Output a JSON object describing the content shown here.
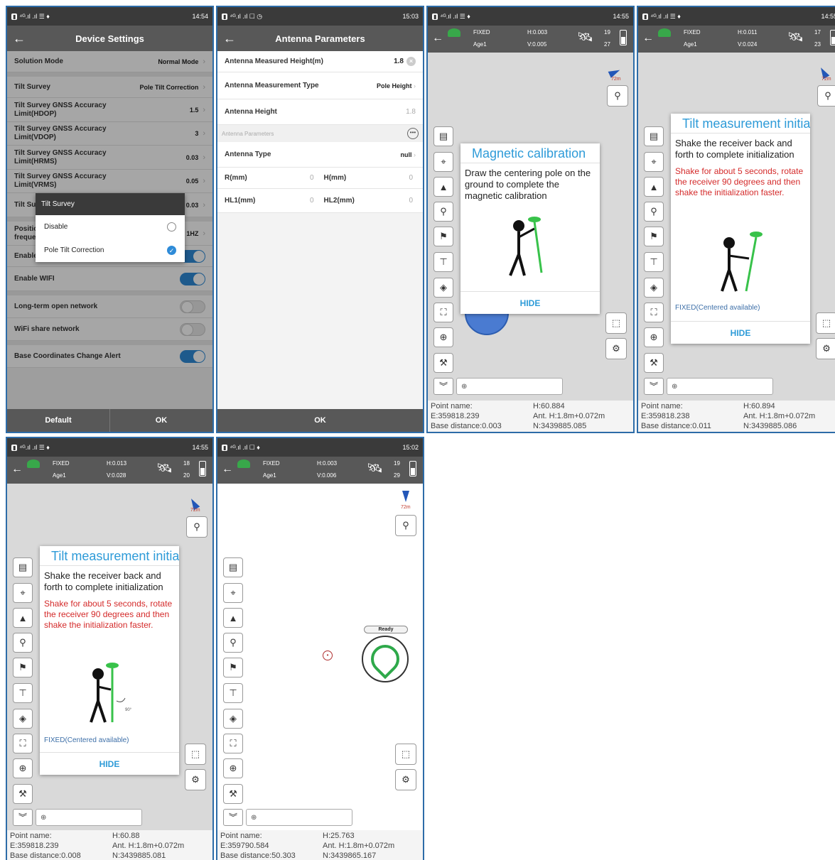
{
  "device_settings": {
    "status_time": "14:54",
    "title": "Device Settings",
    "rows": [
      {
        "label": "Solution Mode",
        "value": "Normal Mode"
      },
      {
        "label": "Tilt Survey",
        "value": "Pole Tilt Correction"
      },
      {
        "label": "Tilt Survey GNSS Accuracy Limit(HDOP)",
        "value": "1.5"
      },
      {
        "label": "Tilt Survey GNSS Accuracy Limit(VDOP)",
        "value": "3"
      },
      {
        "label": "Tilt Survey GNSS Accuracy Limit(HRMS)",
        "value": "0.03"
      },
      {
        "label": "Tilt Survey GNSS Accuracy Limit(VRMS)",
        "value": "0.05"
      },
      {
        "label": "Tilt Survey Limit",
        "value": "0.03"
      },
      {
        "label": "Positioning frequency",
        "value": "1HZ"
      },
      {
        "label": "Enable voice"
      },
      {
        "label": "Enable WIFI"
      },
      {
        "label": "Long-term open network"
      },
      {
        "label": "WiFi share network"
      },
      {
        "label": "Base Coordinates Change Alert"
      }
    ],
    "popup": {
      "title": "Tilt Survey",
      "options": [
        "Disable",
        "Pole Tilt Correction"
      ]
    },
    "default_label": "Default",
    "ok_label": "OK"
  },
  "antenna": {
    "status_time": "15:03",
    "title": "Antenna Parameters",
    "measured_height_label": "Antenna Measured Height(m)",
    "measured_height_value": "1.8",
    "measurement_type_label": "Antenna Measurement Type",
    "measurement_type_value": "Pole Height",
    "height_label": "Antenna Height",
    "height_value": "1.8",
    "section_label": "Antenna Parameters",
    "type_label": "Antenna Type",
    "type_value": "null",
    "r_label": "R(mm)",
    "r_value": "0",
    "h_label": "H(mm)",
    "h_value": "0",
    "hl1_label": "HL1(mm)",
    "hl1_value": "0",
    "hl2_label": "HL2(mm)",
    "hl2_value": "0",
    "ok_label": "OK"
  },
  "survey_screens": [
    {
      "status_time": "14:55",
      "fix": "FIXED",
      "age": "Age1",
      "h": "H:0.003",
      "v": "V:0.005",
      "sat1": "19",
      "sat2": "27",
      "scale": "72m",
      "dialog": {
        "title": "Magnetic calibration",
        "body": "Draw the centering pole on the ground to complete the magnetic calibration",
        "hide": "HIDE"
      },
      "info": {
        "point": "Point name:",
        "e": "E:359818.239",
        "base": "Base distance:0.003",
        "h": "H:60.884",
        "ant": "Ant. H:1.8m+0.072m",
        "n": "N:3439885.085"
      }
    },
    {
      "status_time": "14:55",
      "fix": "FIXED",
      "age": "Age1",
      "h": "H:0.011",
      "v": "V:0.024",
      "sat1": "17",
      "sat2": "23",
      "scale": "72m",
      "dialog": {
        "title": "Tilt measurement initialization",
        "body": "Shake the receiver back and forth to complete initialization",
        "warn": "Shake for about 5 seconds, rotate the receiver 90 degrees and then shake the initialization faster.",
        "fixed": "FIXED(Centered available)",
        "hide": "HIDE"
      },
      "info": {
        "point": "Point name:",
        "e": "E:359818.238",
        "base": "Base distance:0.011",
        "h": "H:60.894",
        "ant": "Ant. H:1.8m+0.072m",
        "n": "N:3439885.086"
      }
    },
    {
      "status_time": "14:55",
      "fix": "FIXED",
      "age": "Age1",
      "h": "H:0.013",
      "v": "V:0.028",
      "sat1": "18",
      "sat2": "20",
      "scale": "72m",
      "dialog": {
        "title": "Tilt measurement initialization",
        "body": "Shake the receiver back and forth to complete initialization",
        "warn": "Shake for about 5 seconds, rotate the receiver 90 degrees and then shake the initialization faster.",
        "fixed": "FIXED(Centered available)",
        "angle": "90°",
        "hide": "HIDE"
      },
      "info": {
        "point": "Point name:",
        "e": "E:359818.239",
        "base": "Base distance:0.008",
        "h": "H:60.88",
        "ant": "Ant. H:1.8m+0.072m",
        "n": "N:3439885.081"
      }
    },
    {
      "status_time": "15:02",
      "fix": "FIXED",
      "age": "Age1",
      "h": "H:0.003",
      "v": "V:0.006",
      "sat1": "19",
      "sat2": "29",
      "scale": "72m",
      "ready": "Ready",
      "info": {
        "point": "Point name:",
        "e": "E:359790.584",
        "base": "Base distance:50.303",
        "h": "H:25.763",
        "ant": "Ant. H:1.8m+0.072m",
        "n": "N:3439865.167"
      }
    }
  ],
  "colors": {
    "accent": "#2e9bd8",
    "warning": "#d42a2a",
    "toolbar": "#585858",
    "gnss_green": "#38a84a"
  }
}
